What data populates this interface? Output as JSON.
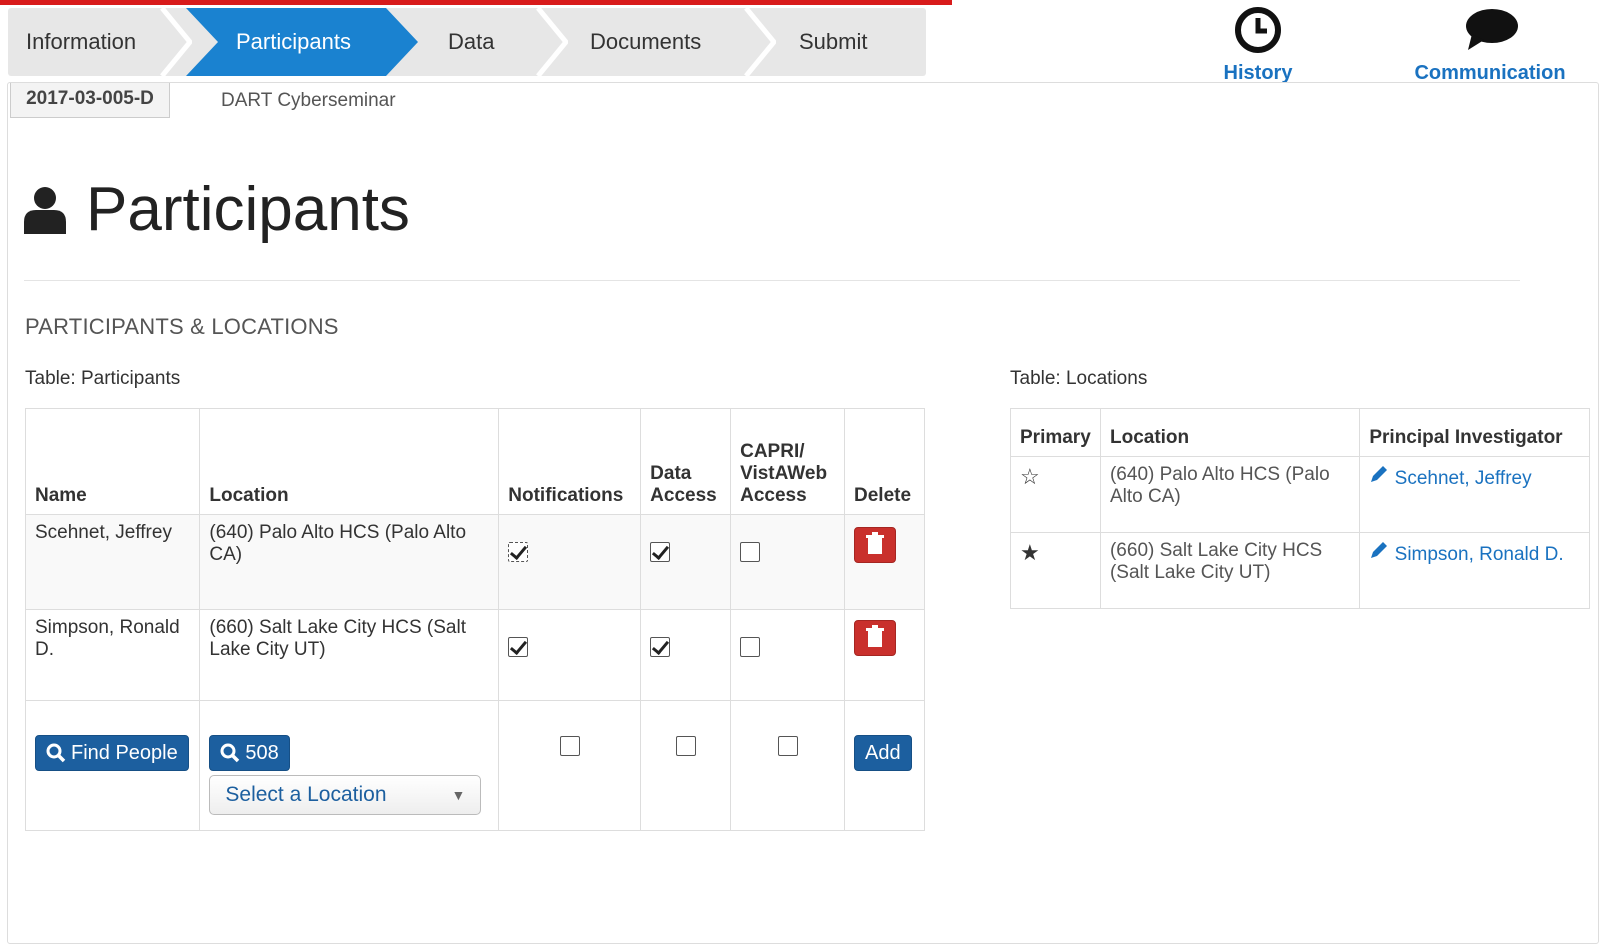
{
  "wizard": {
    "steps": [
      {
        "label": "Information"
      },
      {
        "label": "Participants"
      },
      {
        "label": "Data"
      },
      {
        "label": "Documents"
      },
      {
        "label": "Submit"
      }
    ],
    "active_index": 1,
    "accent": "#1a82d0"
  },
  "header_actions": {
    "history": {
      "label": "History",
      "icon": "clock-icon"
    },
    "communication": {
      "label": "Communication",
      "icon": "speech-bubble-icon"
    }
  },
  "case": {
    "id": "2017-03-005-D",
    "name": "DART Cyberseminar"
  },
  "page": {
    "title": "Participants",
    "icon": "user-icon",
    "section": "PARTICIPANTS & LOCATIONS"
  },
  "participants_table": {
    "caption": "Table: Participants",
    "headers": {
      "name": "Name",
      "location": "Location",
      "notifications": "Notifications",
      "data_access_1": "Data",
      "data_access_2": "Access",
      "capri_1": "CAPRI/",
      "capri_2": "VistAWeb",
      "capri_3": "Access",
      "delete": "Delete"
    },
    "rows": [
      {
        "name": "Scehnet, Jeffrey",
        "location": "(640) Palo Alto HCS (Palo Alto CA)",
        "notifications": true,
        "data_access": true,
        "capri": false
      },
      {
        "name": "Simpson, Ronald D.",
        "location": "(660) Salt Lake City HCS (Salt Lake City UT)",
        "notifications": true,
        "data_access": true,
        "capri": false
      }
    ],
    "add_row": {
      "find_people": "Find People",
      "search_508": "508",
      "location_select": "Select a Location",
      "add": "Add"
    }
  },
  "locations_table": {
    "caption": "Table: Locations",
    "headers": {
      "primary": "Primary",
      "location": "Location",
      "pi": "Principal Investigator"
    },
    "rows": [
      {
        "primary": false,
        "location": "(640) Palo Alto HCS (Palo Alto CA)",
        "pi": "Scehnet, Jeffrey"
      },
      {
        "primary": true,
        "location": "(660) Salt Lake City HCS (Salt Lake City UT)",
        "pi": "Simpson, Ronald D."
      }
    ]
  }
}
